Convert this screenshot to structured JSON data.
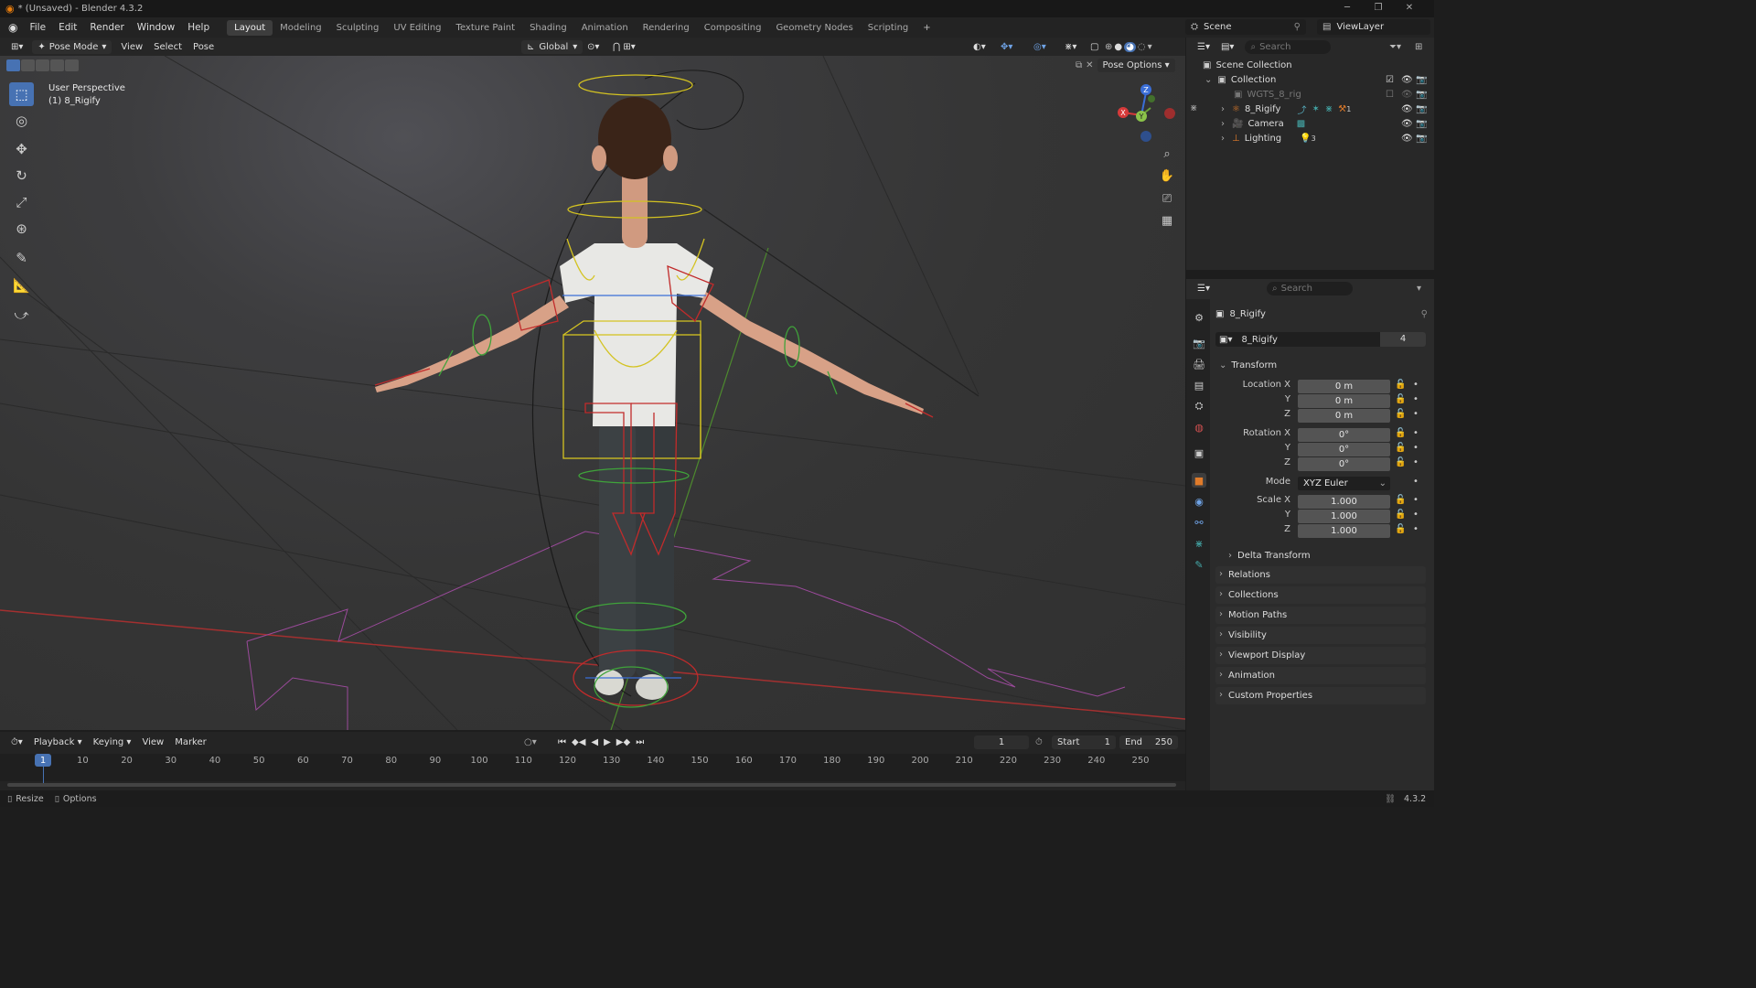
{
  "window": {
    "title": "* (Unsaved) - Blender 4.3.2"
  },
  "menus": [
    "File",
    "Edit",
    "Render",
    "Window",
    "Help"
  ],
  "workspaces": [
    "Layout",
    "Modeling",
    "Sculpting",
    "UV Editing",
    "Texture Paint",
    "Shading",
    "Animation",
    "Rendering",
    "Compositing",
    "Geometry Nodes",
    "Scripting"
  ],
  "active_workspace": "Layout",
  "scene": {
    "label": "Scene",
    "view_layer": "ViewLayer"
  },
  "viewport": {
    "mode": "Pose Mode",
    "menus": [
      "View",
      "Select",
      "Pose"
    ],
    "transform_orientation": "Global",
    "pose_options": "Pose Options",
    "overlay_text_1": "User Perspective",
    "overlay_text_2": "(1) 8_Rigify",
    "gizmo_x": "X",
    "gizmo_y": "Y",
    "gizmo_z": "Z"
  },
  "outliner": {
    "search_placeholder": "Search",
    "scene_collection": "Scene Collection",
    "collection": "Collection",
    "items": [
      {
        "name": "WGTS_8_rig"
      },
      {
        "name": "8_Rigify",
        "badge": "1"
      },
      {
        "name": "Camera"
      },
      {
        "name": "Lighting",
        "badge": "3"
      }
    ]
  },
  "properties": {
    "search_placeholder": "Search",
    "object_name": "8_Rigify",
    "data_name": "8_Rigify",
    "users": "4",
    "transform_label": "Transform",
    "location": {
      "x_label": "Location X",
      "y_label": "Y",
      "z_label": "Z",
      "x": "0 m",
      "y": "0 m",
      "z": "0 m"
    },
    "rotation": {
      "x_label": "Rotation X",
      "y_label": "Y",
      "z_label": "Z",
      "x": "0°",
      "y": "0°",
      "z": "0°"
    },
    "mode_label": "Mode",
    "mode_value": "XYZ Euler",
    "scale": {
      "x_label": "Scale X",
      "y_label": "Y",
      "z_label": "Z",
      "x": "1.000",
      "y": "1.000",
      "z": "1.000"
    },
    "delta_transform": "Delta Transform",
    "panels": [
      "Relations",
      "Collections",
      "Motion Paths",
      "Visibility",
      "Viewport Display",
      "Animation",
      "Custom Properties"
    ]
  },
  "timeline": {
    "menus": [
      "Playback",
      "Keying",
      "View",
      "Marker"
    ],
    "current_frame": "1",
    "start_label": "Start",
    "start": "1",
    "end_label": "End",
    "end": "250",
    "ticks": [
      "1",
      "10",
      "20",
      "30",
      "40",
      "50",
      "60",
      "70",
      "80",
      "90",
      "100",
      "110",
      "120",
      "130",
      "140",
      "150",
      "160",
      "170",
      "180",
      "190",
      "200",
      "210",
      "220",
      "230",
      "240",
      "250"
    ]
  },
  "statusbar": {
    "resize": "Resize",
    "options": "Options",
    "version": "4.3.2"
  },
  "colors": {
    "accent": "#4772b3",
    "x_axis": "#d63a3a",
    "y_axis": "#6ba03a",
    "z_axis": "#3a6ed6",
    "orange_icon": "#e07b2a"
  }
}
